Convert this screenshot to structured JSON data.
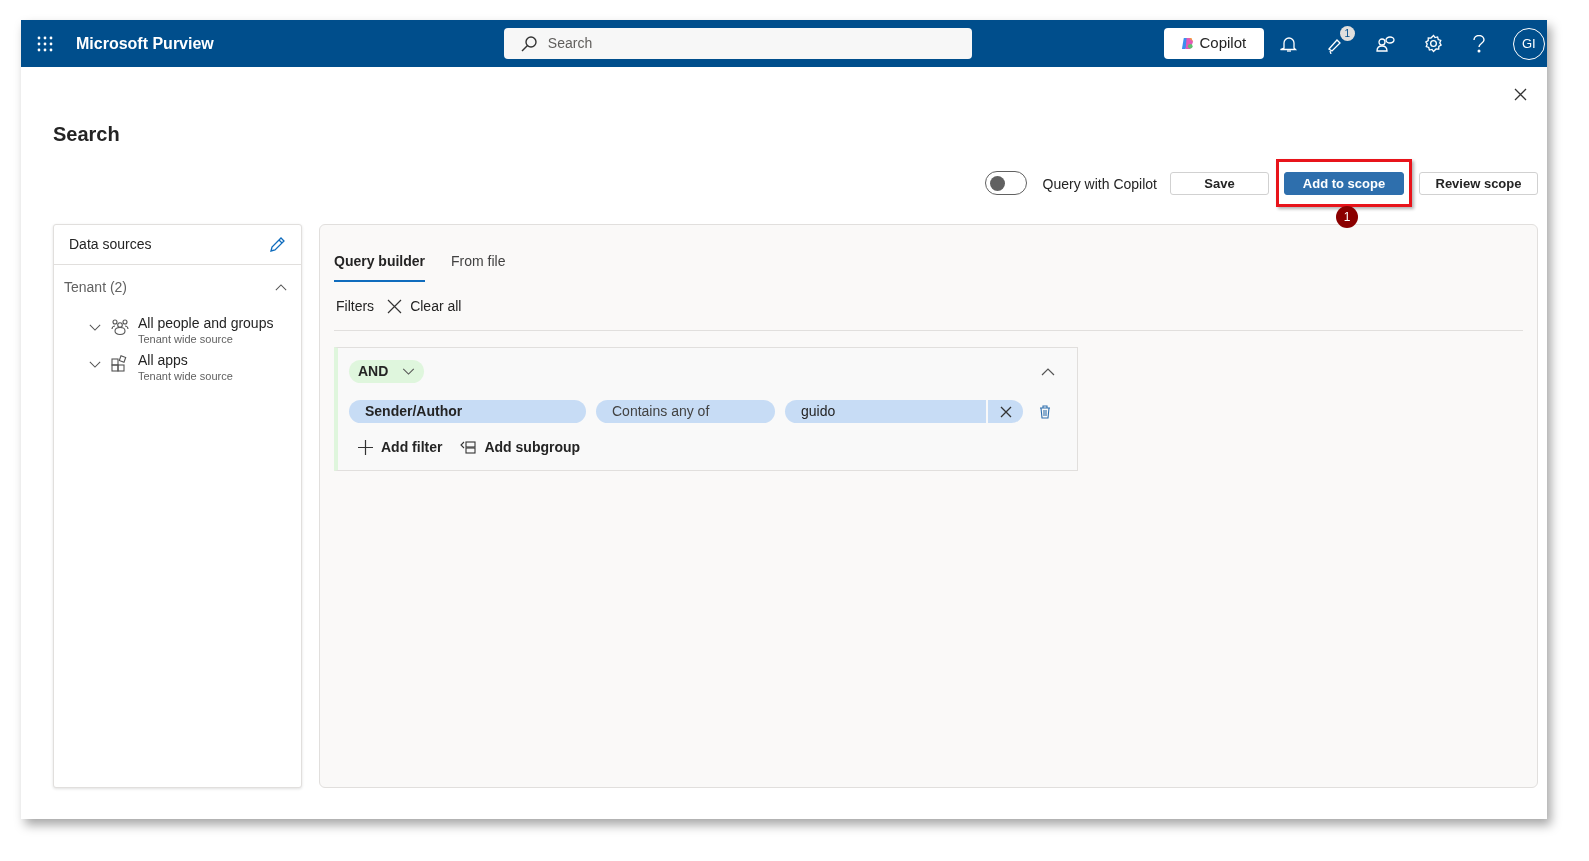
{
  "header": {
    "app_title": "Microsoft Purview",
    "search": {
      "placeholder": "Search"
    },
    "copilot_button": "Copilot",
    "notification_badge": "1",
    "avatar": "GI"
  },
  "page": {
    "title": "Search"
  },
  "toolbar": {
    "copilot_toggle": {
      "label": "Query with Copilot",
      "on": false
    },
    "buttons": [
      {
        "label": "Save",
        "kind": "secondary",
        "highlighted": false
      },
      {
        "label": "Add to scope",
        "kind": "primary",
        "highlighted": true,
        "callout": "1"
      },
      {
        "label": "Review scope",
        "kind": "secondary",
        "highlighted": false
      }
    ]
  },
  "data_sources": {
    "title": "Data sources",
    "group": {
      "label": "Tenant (2)",
      "expanded": true,
      "items": [
        {
          "name": "All people and groups",
          "subtitle": "Tenant wide source",
          "kind": "people",
          "expanded": false
        },
        {
          "name": "All apps",
          "subtitle": "Tenant wide source",
          "kind": "apps",
          "expanded": false
        }
      ]
    }
  },
  "query": {
    "tabs": [
      {
        "label": "Query builder",
        "selected": true
      },
      {
        "label": "From file",
        "selected": false
      }
    ],
    "filters_label": "Filters",
    "clear_all": "Clear all",
    "group": {
      "operator": "AND",
      "expanded": true,
      "conditions": [
        {
          "field": "Sender/Author",
          "operator": "Contains any of",
          "value": "guido"
        }
      ],
      "add_filter": "Add filter",
      "add_subgroup": "Add subgroup"
    }
  }
}
